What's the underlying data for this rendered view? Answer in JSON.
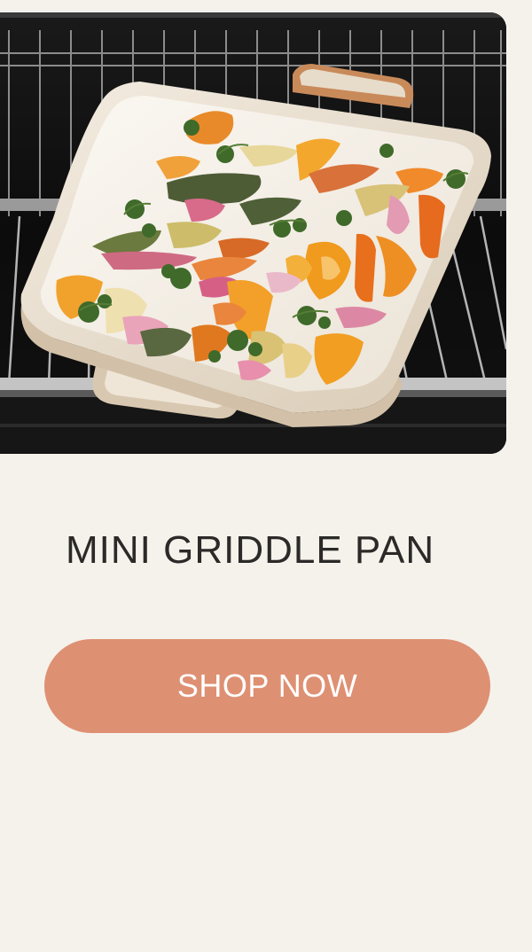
{
  "product": {
    "title": "MINI GRIDDLE PAN",
    "image_alt": "Roasted vegetables in a cream griddle pan on an oven rack"
  },
  "cta": {
    "label": "SHOP NOW"
  },
  "colors": {
    "background": "#f5f2ec",
    "title": "#2c2a28",
    "cta_background": "#de9073",
    "cta_text": "#ffffff",
    "pan": "#efe6d8",
    "oven": "#0d0d0d"
  }
}
